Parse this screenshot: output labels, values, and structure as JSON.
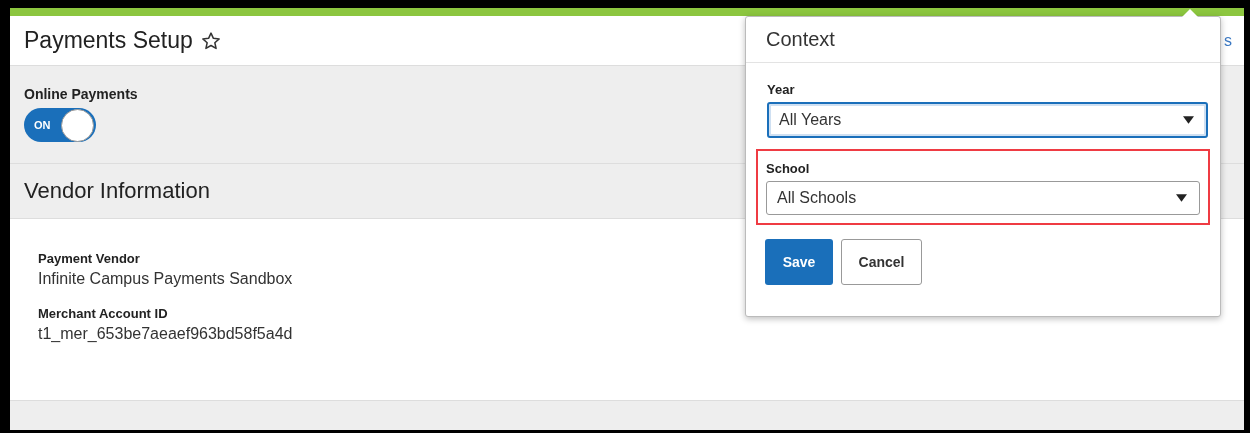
{
  "page": {
    "title": "Payments Setup",
    "header_link": "s"
  },
  "online_payments": {
    "label": "Online Payments",
    "toggle_text": "ON",
    "on": true
  },
  "vendor_information": {
    "heading": "Vendor Information",
    "fields": [
      {
        "label": "Payment Vendor",
        "value": "Infinite Campus Payments Sandbox"
      },
      {
        "label": "Merchant Account ID",
        "value": "t1_mer_653be7aeaef963bd58f5a4d"
      }
    ]
  },
  "context_popover": {
    "title": "Context",
    "fields": [
      {
        "label": "Year",
        "value": "All Years",
        "focused": true,
        "highlighted": false
      },
      {
        "label": "School",
        "value": "All Schools",
        "focused": false,
        "highlighted": true
      }
    ],
    "buttons": [
      {
        "label": "Save",
        "kind": "primary"
      },
      {
        "label": "Cancel",
        "kind": "secondary"
      }
    ]
  }
}
